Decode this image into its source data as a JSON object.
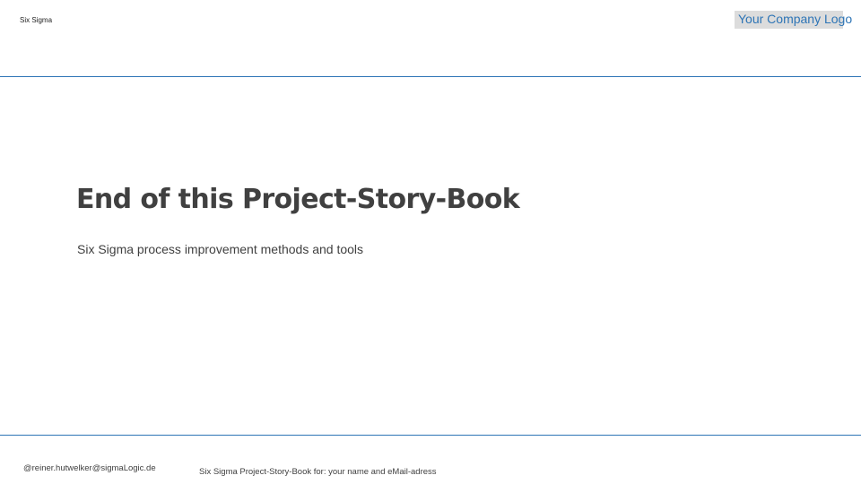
{
  "header": {
    "label": "Six Sigma",
    "logo_text": "Your Company Logo"
  },
  "main": {
    "title": "End of this Project-Story-Book",
    "subtitle": "Six Sigma process improvement methods and tools"
  },
  "footer": {
    "email": "@reiner.hutwelker@sigmaLogic.de",
    "center_text": "Six Sigma Project-Story-Book for: your name and eMail-adress"
  },
  "colors": {
    "accent": "#2e75b6",
    "text": "#404040",
    "logo_background": "#dcdcdc"
  }
}
